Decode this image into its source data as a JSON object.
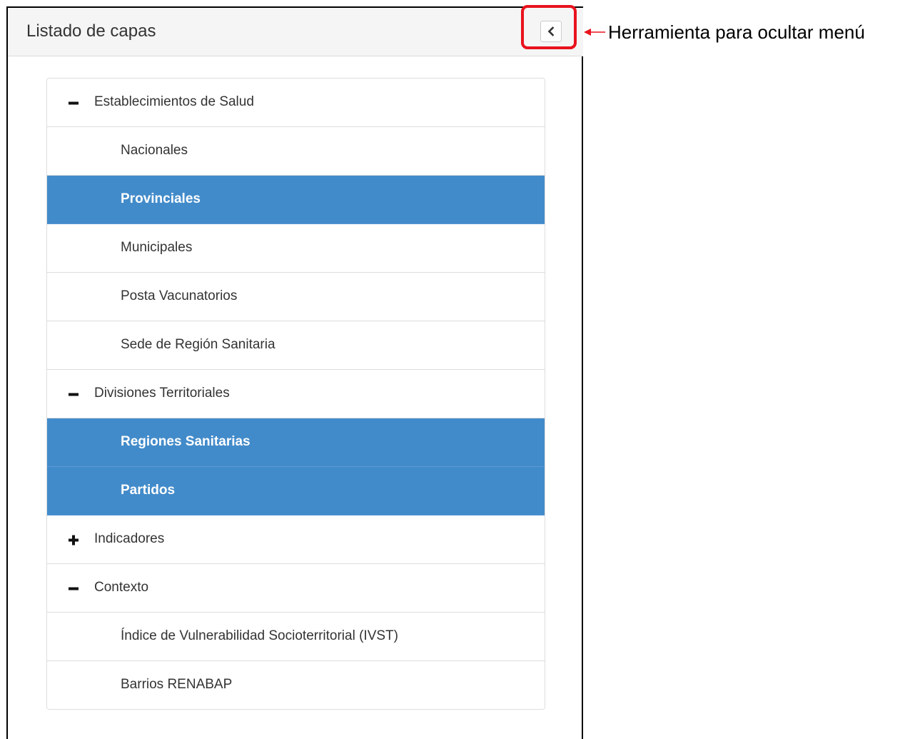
{
  "panel": {
    "title": "Listado de capas",
    "collapse_icon": "chevron-left-icon"
  },
  "annotation": {
    "text": "Herramienta para ocultar menú",
    "color": "#e8131d"
  },
  "colors": {
    "active_item": "#428bca",
    "header_bg": "#f5f5f5"
  },
  "layers": [
    {
      "label": "Establecimientos de Salud",
      "type": "group",
      "expanded": true,
      "icon": "minus-icon"
    },
    {
      "label": "Nacionales",
      "type": "sub",
      "active": false
    },
    {
      "label": "Provinciales",
      "type": "sub",
      "active": true
    },
    {
      "label": "Municipales",
      "type": "sub",
      "active": false
    },
    {
      "label": "Posta Vacunatorios",
      "type": "sub",
      "active": false
    },
    {
      "label": "Sede de Región Sanitaria",
      "type": "sub",
      "active": false
    },
    {
      "label": "Divisiones Territoriales",
      "type": "group",
      "expanded": true,
      "icon": "minus-icon"
    },
    {
      "label": "Regiones Sanitarias",
      "type": "sub",
      "active": true
    },
    {
      "label": "Partidos",
      "type": "sub",
      "active": true
    },
    {
      "label": "Indicadores",
      "type": "group",
      "expanded": false,
      "icon": "plus-icon"
    },
    {
      "label": "Contexto",
      "type": "group",
      "expanded": true,
      "icon": "minus-icon"
    },
    {
      "label": "Índice de Vulnerabilidad Socioterritorial (IVST)",
      "type": "sub",
      "active": false
    },
    {
      "label": "Barrios RENABAP",
      "type": "sub",
      "active": false
    }
  ]
}
